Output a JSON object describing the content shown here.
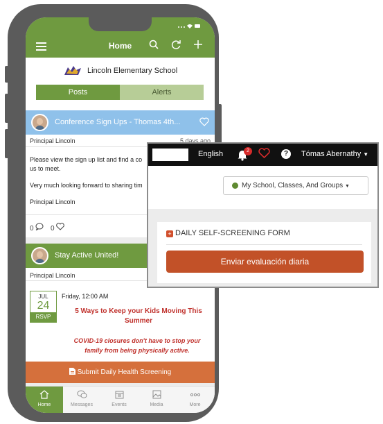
{
  "colors": {
    "brand_green": "#6f9a40",
    "light_green": "#b7cd97",
    "orange": "#d5703c",
    "red_text": "#c0312c",
    "conference_blue": "#8fc1ea"
  },
  "app": {
    "title": "Home",
    "school_name": "Lincoln Elementary School",
    "tabs": {
      "posts": "Posts",
      "alerts": "Alerts"
    }
  },
  "post1": {
    "title": "Conference Sign Ups - Thomas 4th...",
    "author": "Principal Lincoln",
    "time_ago": "5 days ago",
    "line1": "Please view the sign up list and find a co",
    "line2": "us to meet.",
    "line3": "Very much looking forward to sharing tim",
    "signature": "Principal Lincoln",
    "comments": "0",
    "likes": "0"
  },
  "post2": {
    "title": "Stay Active United!",
    "author": "Principal Lincoln",
    "event_time": "Friday, 12:00 AM",
    "month": "JUL",
    "day": "24",
    "rsvp": "RSVP",
    "headline_1": "5 Ways to Keep your Kids Moving This",
    "headline_2": "Summer",
    "italic_1": "COVID-19 closures don't have to stop your",
    "italic_2": "family from being physically active."
  },
  "health_button": "Submit Daily Health Screening",
  "bottom_tabs": [
    {
      "label": "Home",
      "icon": "home-icon"
    },
    {
      "label": "Messages",
      "icon": "messages-icon"
    },
    {
      "label": "Events",
      "icon": "events-icon"
    },
    {
      "label": "Media",
      "icon": "media-icon"
    },
    {
      "label": "More",
      "icon": "more-icon"
    }
  ],
  "desktop": {
    "language": "English",
    "notification_count": "2",
    "user_name": "Tómas Abernathy",
    "scope_select": "My School, Classes, And Groups",
    "form_title": "DAILY SELF-SCREENING FORM",
    "submit_label": "Enviar evaluación diaria"
  }
}
